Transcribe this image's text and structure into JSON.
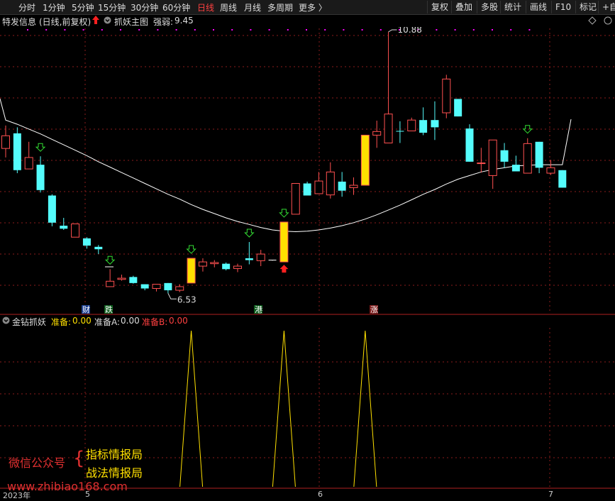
{
  "periods": [
    "分时",
    "1分钟",
    "5分钟",
    "15分钟",
    "30分钟",
    "60分钟",
    "日线",
    "周线",
    "月线",
    "多周期",
    "更多 〉"
  ],
  "active_period": "日线",
  "right_buttons": [
    "复权",
    "叠加",
    "多股",
    "统计",
    "画线",
    "F10",
    "标记",
    "+自"
  ],
  "info": {
    "stock_name": "特发信息",
    "adjust_mode": "(日线,前复权)",
    "indicator_name": "抓妖主图",
    "strength_label": "强弱:",
    "strength_value": "9.45"
  },
  "indicator": {
    "name": "金钻抓妖",
    "prep_label": "准备:",
    "prep_value": "0.00",
    "prepA_label": "准备A:",
    "prepA_value": "0.00",
    "prepB_label": "准备B:",
    "prepB_value": "0.00"
  },
  "annotations": {
    "high": "10.88",
    "low": "6.53"
  },
  "event_tags": [
    "财",
    "跌",
    "港",
    "涨"
  ],
  "watermark": {
    "line1": "微信公众号",
    "brace": "{",
    "item1": "指标情报局",
    "item2": "战法情报局",
    "url": "www.zhibiao168.com"
  },
  "x_axis_labels": [
    "2023年",
    "5",
    "6",
    "7"
  ],
  "colors": {
    "up": "#ff5050",
    "down": "#54fcfc",
    "signal": "#ffe000",
    "ma": "#ffffff",
    "active_tab": "#ff4040",
    "marker": "#ff00ff"
  },
  "chart_data": [
    {
      "type": "candlestick",
      "title": "抓妖主图",
      "period": "日线",
      "annotations": [
        {
          "label": "10.88",
          "kind": "high"
        },
        {
          "label": "6.53",
          "kind": "low"
        }
      ],
      "candles": [
        {
          "o": 8.95,
          "h": 9.33,
          "l": 8.8,
          "c": 9.16,
          "color": "up"
        },
        {
          "o": 9.2,
          "h": 9.3,
          "l": 8.54,
          "c": 8.59,
          "color": "down"
        },
        {
          "o": 8.61,
          "h": 9.06,
          "l": 8.61,
          "c": 8.8,
          "color": "up"
        },
        {
          "o": 8.68,
          "h": 8.82,
          "l": 8.22,
          "c": 8.26,
          "color": "down",
          "arrow": "down"
        },
        {
          "o": 8.17,
          "h": 8.19,
          "l": 7.66,
          "c": 7.72,
          "color": "down"
        },
        {
          "o": 7.67,
          "h": 7.8,
          "l": 7.6,
          "c": 7.62,
          "color": "down"
        },
        {
          "o": 7.48,
          "h": 7.7,
          "l": 7.48,
          "c": 7.7,
          "color": "up"
        },
        {
          "o": 7.46,
          "h": 7.48,
          "l": 7.29,
          "c": 7.34,
          "color": "down"
        },
        {
          "o": 7.32,
          "h": 7.35,
          "l": 7.2,
          "c": 7.28,
          "color": "down"
        },
        {
          "o": 6.66,
          "h": 6.95,
          "l": 6.66,
          "c": 6.75,
          "color": "up",
          "arrow": "down"
        },
        {
          "o": 6.78,
          "h": 6.86,
          "l": 6.76,
          "c": 6.8,
          "color": "up"
        },
        {
          "o": 6.82,
          "h": 6.84,
          "l": 6.71,
          "c": 6.72,
          "color": "down"
        },
        {
          "o": 6.7,
          "h": 6.7,
          "l": 6.6,
          "c": 6.63,
          "color": "down"
        },
        {
          "o": 6.63,
          "h": 6.7,
          "l": 6.58,
          "c": 6.7,
          "color": "up"
        },
        {
          "o": 6.72,
          "h": 6.72,
          "l": 6.55,
          "c": 6.6,
          "color": "down"
        },
        {
          "o": 6.6,
          "h": 6.7,
          "l": 6.57,
          "c": 6.66,
          "color": "up"
        },
        {
          "o": 6.72,
          "h": 7.13,
          "l": 6.72,
          "c": 7.13,
          "color": "signal",
          "arrow": "down"
        },
        {
          "o": 7.0,
          "h": 7.13,
          "l": 6.91,
          "c": 7.07,
          "color": "up"
        },
        {
          "o": 7.04,
          "h": 7.1,
          "l": 6.98,
          "c": 7.06,
          "color": "up"
        },
        {
          "o": 7.04,
          "h": 7.06,
          "l": 6.93,
          "c": 6.95,
          "color": "down"
        },
        {
          "o": 6.96,
          "h": 7.04,
          "l": 6.9,
          "c": 7.0,
          "color": "up"
        },
        {
          "o": 7.13,
          "h": 7.4,
          "l": 7.03,
          "c": 7.1,
          "color": "down",
          "arrow": "down"
        },
        {
          "o": 7.09,
          "h": 7.27,
          "l": 7.0,
          "c": 7.2,
          "color": "up"
        },
        {
          "o": 7.1,
          "h": 7.1,
          "l": 7.09,
          "c": 7.09,
          "color": "flat"
        },
        {
          "o": 7.07,
          "h": 7.73,
          "l": 7.07,
          "c": 7.73,
          "color": "signal",
          "arrow": "down",
          "signal_up": true
        },
        {
          "o": 7.86,
          "h": 8.37,
          "l": 7.86,
          "c": 8.37,
          "color": "up"
        },
        {
          "o": 8.37,
          "h": 8.4,
          "l": 8.17,
          "c": 8.17,
          "color": "down"
        },
        {
          "o": 8.2,
          "h": 8.56,
          "l": 8.2,
          "c": 8.41,
          "color": "up"
        },
        {
          "o": 8.18,
          "h": 8.72,
          "l": 8.12,
          "c": 8.56,
          "color": "up"
        },
        {
          "o": 8.4,
          "h": 8.56,
          "l": 8.15,
          "c": 8.25,
          "color": "down"
        },
        {
          "o": 8.3,
          "h": 8.47,
          "l": 8.18,
          "c": 8.34,
          "color": "up"
        },
        {
          "o": 8.34,
          "h": 9.17,
          "l": 8.34,
          "c": 9.17,
          "color": "signal"
        },
        {
          "o": 9.17,
          "h": 9.41,
          "l": 8.96,
          "c": 9.23,
          "color": "up"
        },
        {
          "o": 9.04,
          "h": 10.88,
          "l": 9.04,
          "c": 9.52,
          "color": "up"
        },
        {
          "o": 9.24,
          "h": 9.4,
          "l": 9.04,
          "c": 9.24,
          "color": "down"
        },
        {
          "o": 9.24,
          "h": 9.46,
          "l": 9.24,
          "c": 9.42,
          "color": "up"
        },
        {
          "o": 9.42,
          "h": 9.63,
          "l": 9.17,
          "c": 9.21,
          "color": "down"
        },
        {
          "o": 9.42,
          "h": 9.73,
          "l": 9.09,
          "c": 9.3,
          "color": "down"
        },
        {
          "o": 9.54,
          "h": 10.17,
          "l": 9.45,
          "c": 10.1,
          "color": "up"
        },
        {
          "o": 9.77,
          "h": 9.77,
          "l": 9.48,
          "c": 9.48,
          "color": "down"
        },
        {
          "o": 9.28,
          "h": 9.35,
          "l": 8.73,
          "c": 8.73,
          "color": "down"
        },
        {
          "o": 8.7,
          "h": 8.96,
          "l": 8.55,
          "c": 8.71,
          "color": "up"
        },
        {
          "o": 8.5,
          "h": 9.09,
          "l": 8.28,
          "c": 9.09,
          "color": "up"
        },
        {
          "o": 8.92,
          "h": 9.04,
          "l": 8.63,
          "c": 8.73,
          "color": "down"
        },
        {
          "o": 8.68,
          "h": 8.83,
          "l": 8.57,
          "c": 8.57,
          "color": "down"
        },
        {
          "o": 8.54,
          "h": 9.12,
          "l": 8.54,
          "c": 9.03,
          "color": "up",
          "arrow": "down"
        },
        {
          "o": 9.06,
          "h": 9.06,
          "l": 8.54,
          "c": 8.63,
          "color": "down"
        },
        {
          "o": 8.54,
          "h": 8.76,
          "l": 8.51,
          "c": 8.63,
          "color": "up"
        },
        {
          "o": 8.59,
          "h": 8.59,
          "l": 8.3,
          "c": 8.3,
          "color": "down"
        }
      ],
      "ma_line": [
        9.42,
        9.35,
        9.27,
        9.19,
        9.1,
        9.01,
        8.92,
        8.83,
        8.73,
        8.64,
        8.55,
        8.46,
        8.37,
        8.28,
        8.19,
        8.11,
        8.02,
        7.94,
        7.87,
        7.8,
        7.74,
        7.69,
        7.64,
        7.6,
        7.58,
        7.57,
        7.58,
        7.6,
        7.63,
        7.67,
        7.72,
        7.78,
        7.85,
        7.93,
        8.01,
        8.1,
        8.19,
        8.27,
        8.36,
        8.44,
        8.5,
        8.56,
        8.6,
        8.63,
        8.66,
        8.67,
        8.68,
        8.68,
        8.68
      ]
    },
    {
      "type": "line",
      "title": "金钻抓妖",
      "series": [
        {
          "name": "准备",
          "peaks_at_candle": [
            16,
            24,
            31
          ],
          "peak_value": 1,
          "base_value": 0
        }
      ]
    }
  ]
}
